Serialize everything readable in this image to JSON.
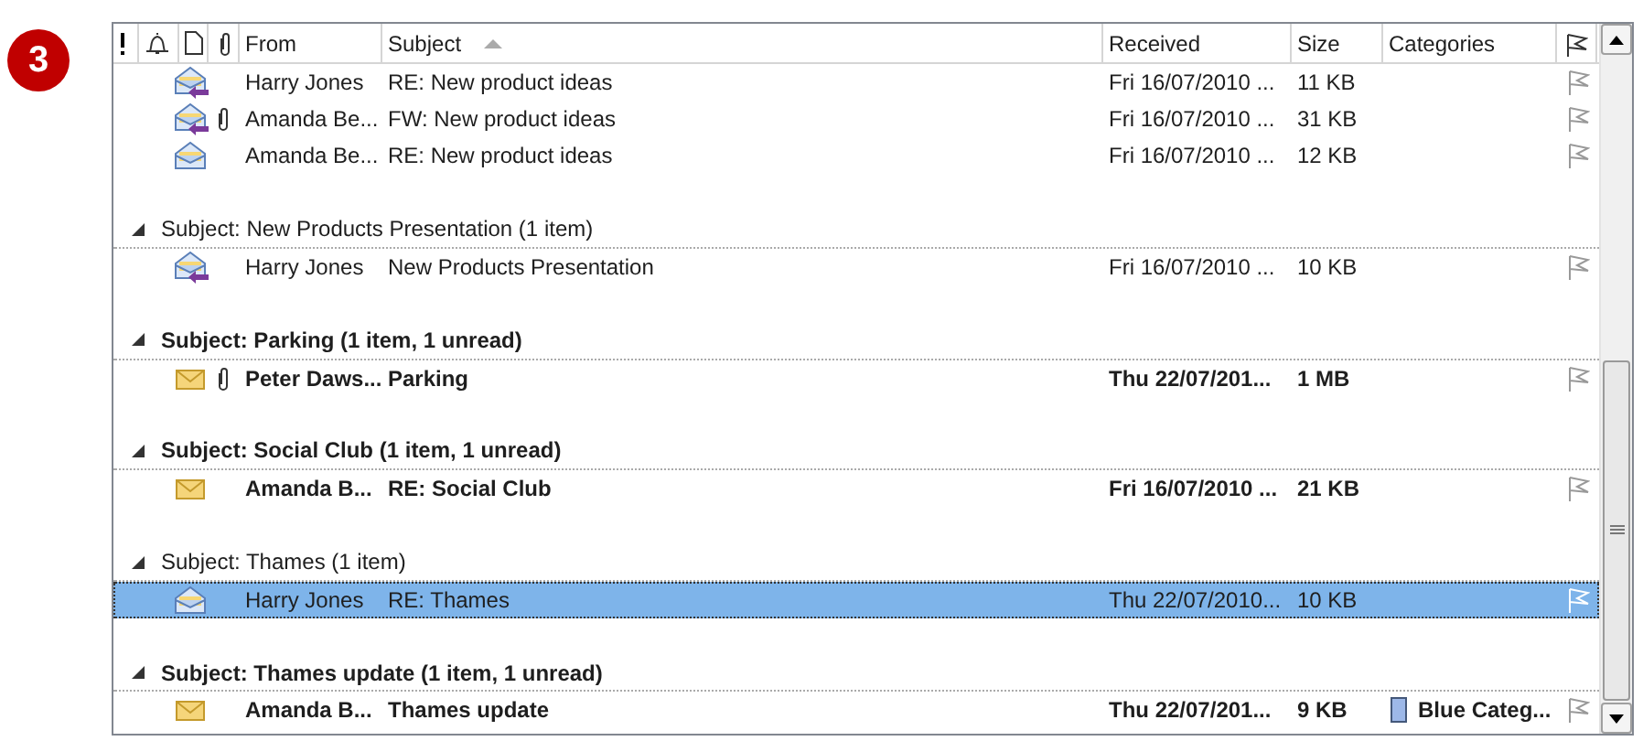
{
  "step_badge": "3",
  "columns": [
    {
      "kind": "importance",
      "sorted": false
    },
    {
      "kind": "reminder",
      "sorted": false
    },
    {
      "kind": "type",
      "sorted": false
    },
    {
      "kind": "attachment",
      "sorted": false
    },
    {
      "kind": "text",
      "label": "From",
      "sorted": false
    },
    {
      "kind": "text",
      "label": "Subject",
      "sorted": true
    },
    {
      "kind": "text",
      "label": "Received",
      "sorted": false
    },
    {
      "kind": "text",
      "label": "Size",
      "sorted": false
    },
    {
      "kind": "text",
      "label": "Categories",
      "sorted": false
    },
    {
      "kind": "flag",
      "sorted": false
    }
  ],
  "rows": [
    {
      "kind": "message",
      "replied": true,
      "attachment": false,
      "unread": false,
      "selected": false,
      "from": "Harry Jones",
      "subject": "RE: New product ideas",
      "received": "Fri 16/07/2010 ...",
      "size": "11 KB"
    },
    {
      "kind": "message",
      "replied": true,
      "attachment": true,
      "unread": false,
      "selected": false,
      "from": "Amanda Be...",
      "subject": "FW: New product ideas",
      "received": "Fri 16/07/2010 ...",
      "size": "31 KB"
    },
    {
      "kind": "message",
      "replied": false,
      "attachment": false,
      "unread": false,
      "selected": false,
      "from": "Amanda Be...",
      "subject": "RE: New product ideas",
      "received": "Fri 16/07/2010 ...",
      "size": "12 KB"
    },
    {
      "kind": "group",
      "expanded": true,
      "unread": false,
      "label": "Subject: New Products Presentation (1 item)"
    },
    {
      "kind": "message",
      "replied": true,
      "attachment": false,
      "unread": false,
      "selected": false,
      "from": "Harry Jones",
      "subject": "New Products Presentation",
      "received": "Fri 16/07/2010 ...",
      "size": "10 KB"
    },
    {
      "kind": "group",
      "expanded": true,
      "unread": true,
      "label": "Subject: Parking (1 item, 1 unread)"
    },
    {
      "kind": "message",
      "replied": false,
      "attachment": true,
      "unread": true,
      "selected": false,
      "from": "Peter Daws...",
      "subject": "Parking",
      "received": "Thu 22/07/201...",
      "size": "1 MB"
    },
    {
      "kind": "group",
      "expanded": true,
      "unread": true,
      "label": "Subject: Social Club (1 item, 1 unread)"
    },
    {
      "kind": "message",
      "replied": false,
      "attachment": false,
      "unread": true,
      "selected": false,
      "from": "Amanda B...",
      "subject": "RE: Social Club",
      "received": "Fri 16/07/2010 ...",
      "size": "21 KB"
    },
    {
      "kind": "group",
      "expanded": true,
      "unread": false,
      "label": "Subject: Thames (1 item)"
    },
    {
      "kind": "message",
      "replied": false,
      "attachment": false,
      "unread": false,
      "selected": true,
      "from": "Harry Jones",
      "subject": "RE: Thames",
      "received": "Thu 22/07/2010...",
      "size": "10 KB"
    },
    {
      "kind": "group",
      "expanded": true,
      "unread": true,
      "label": "Subject: Thames update (1 item, 1 unread)"
    },
    {
      "kind": "message",
      "replied": false,
      "attachment": false,
      "unread": true,
      "selected": false,
      "from": "Amanda B...",
      "subject": "Thames update",
      "received": "Thu 22/07/201...",
      "size": "9 KB",
      "category": {
        "label": "Blue Categ...",
        "color": "#9db8e8"
      }
    }
  ]
}
